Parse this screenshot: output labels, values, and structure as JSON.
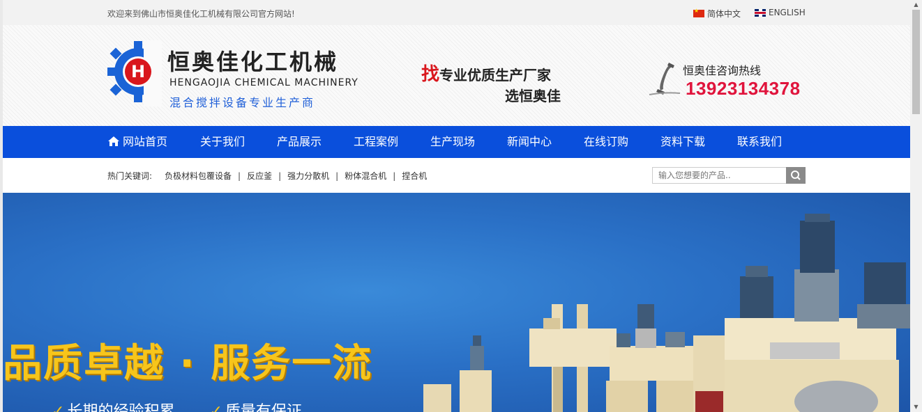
{
  "topbar": {
    "welcome": "欢迎来到佛山市恒奥佳化工机械有限公司官方网站!",
    "lang_cn": "简体中文",
    "lang_en": "ENGLISH"
  },
  "header": {
    "logo_cn": "恒奥佳化工机械",
    "logo_en": "HENGAOJIA CHEMICAL MACHINERY",
    "logo_sub": "混合搅拌设备专业生产商",
    "slogan_big": "找",
    "slogan_line1": "专业优质生产厂家",
    "slogan_line2": "选恒奥佳",
    "hotline_label": "恒奥佳咨询热线",
    "hotline_number": "13923134378"
  },
  "nav": {
    "items": [
      "网站首页",
      "关于我们",
      "产品展示",
      "工程案例",
      "生产现场",
      "新闻中心",
      "在线订购",
      "资料下载",
      "联系我们"
    ]
  },
  "keywords": {
    "label": "热门关键词:",
    "items": [
      "负极材料包覆设备",
      "反应釜",
      "强力分散机",
      "粉体混合机",
      "捏合机"
    ],
    "separator": "|"
  },
  "search": {
    "placeholder": "输入您想要的产品.."
  },
  "banner": {
    "title": "品质卓越 · 服务一流",
    "point1": "长期的经验积累",
    "point2": "质量有保证",
    "check": "✓"
  },
  "colors": {
    "nav_bg": "#0a4fdc",
    "hotline": "#e0143c",
    "banner_title": "#f7c51b",
    "logo_blue": "#1f5fd8"
  }
}
